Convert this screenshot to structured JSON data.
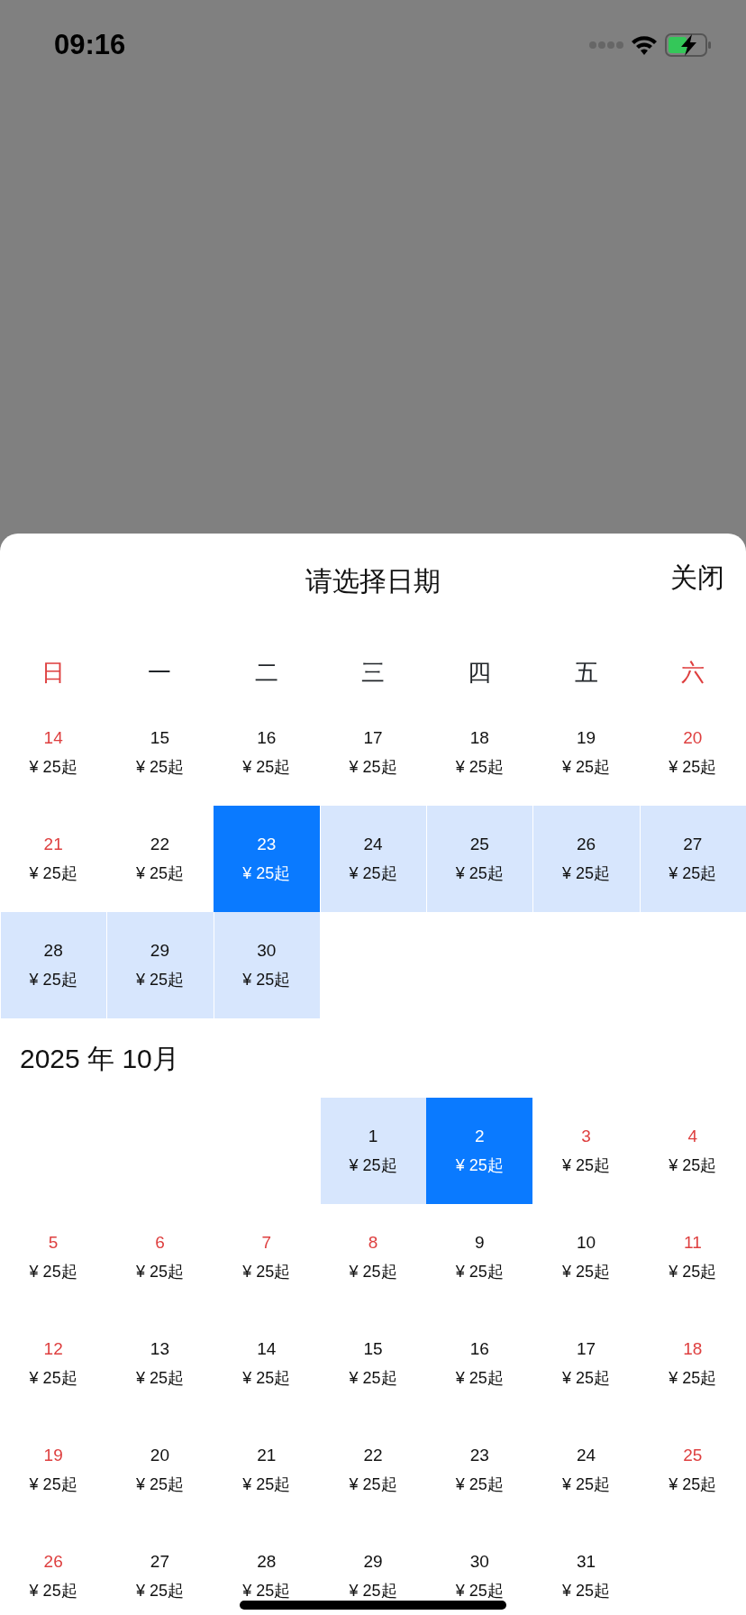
{
  "status_bar": {
    "time": "09:16"
  },
  "sheet": {
    "title": "请选择日期",
    "close_label": "关闭"
  },
  "weekdays": [
    {
      "label": "日",
      "rest_day": true
    },
    {
      "label": "一",
      "rest_day": false
    },
    {
      "label": "二",
      "rest_day": false
    },
    {
      "label": "三",
      "rest_day": false
    },
    {
      "label": "四",
      "rest_day": false
    },
    {
      "label": "五",
      "rest_day": false
    },
    {
      "label": "六",
      "rest_day": true
    }
  ],
  "months": [
    {
      "weeks": [
        [
          {
            "day": "14",
            "price": "¥ 25起",
            "rest_day": true,
            "selected": false,
            "in_range": false
          },
          {
            "day": "15",
            "price": "¥ 25起",
            "rest_day": false,
            "selected": false,
            "in_range": false
          },
          {
            "day": "16",
            "price": "¥ 25起",
            "rest_day": false,
            "selected": false,
            "in_range": false
          },
          {
            "day": "17",
            "price": "¥ 25起",
            "rest_day": false,
            "selected": false,
            "in_range": false
          },
          {
            "day": "18",
            "price": "¥ 25起",
            "rest_day": false,
            "selected": false,
            "in_range": false
          },
          {
            "day": "19",
            "price": "¥ 25起",
            "rest_day": false,
            "selected": false,
            "in_range": false
          },
          {
            "day": "20",
            "price": "¥ 25起",
            "rest_day": true,
            "selected": false,
            "in_range": false
          }
        ],
        [
          {
            "day": "21",
            "price": "¥ 25起",
            "rest_day": true,
            "selected": false,
            "in_range": false
          },
          {
            "day": "22",
            "price": "¥ 25起",
            "rest_day": false,
            "selected": false,
            "in_range": false
          },
          {
            "day": "23",
            "price": "¥ 25起",
            "rest_day": false,
            "selected": true,
            "in_range": false
          },
          {
            "day": "24",
            "price": "¥ 25起",
            "rest_day": false,
            "selected": false,
            "in_range": true
          },
          {
            "day": "25",
            "price": "¥ 25起",
            "rest_day": false,
            "selected": false,
            "in_range": true
          },
          {
            "day": "26",
            "price": "¥ 25起",
            "rest_day": false,
            "selected": false,
            "in_range": true
          },
          {
            "day": "27",
            "price": "¥ 25起",
            "rest_day": false,
            "selected": false,
            "in_range": true
          }
        ],
        [
          {
            "day": "28",
            "price": "¥ 25起",
            "rest_day": false,
            "selected": false,
            "in_range": true
          },
          {
            "day": "29",
            "price": "¥ 25起",
            "rest_day": false,
            "selected": false,
            "in_range": true
          },
          {
            "day": "30",
            "price": "¥ 25起",
            "rest_day": false,
            "selected": false,
            "in_range": true
          }
        ]
      ]
    },
    {
      "title": "2025 年 10月",
      "starts_midweek": true,
      "weeks": [
        [
          {
            "day": "1",
            "price": "¥ 25起",
            "rest_day": false,
            "selected": false,
            "in_range": true
          },
          {
            "day": "2",
            "price": "¥ 25起",
            "rest_day": false,
            "selected": true,
            "in_range": false
          },
          {
            "day": "3",
            "price": "¥ 25起",
            "rest_day": true,
            "selected": false,
            "in_range": false
          },
          {
            "day": "4",
            "price": "¥ 25起",
            "rest_day": true,
            "selected": false,
            "in_range": false
          }
        ],
        [
          {
            "day": "5",
            "price": "¥ 25起",
            "rest_day": true,
            "selected": false,
            "in_range": false
          },
          {
            "day": "6",
            "price": "¥ 25起",
            "rest_day": true,
            "selected": false,
            "in_range": false
          },
          {
            "day": "7",
            "price": "¥ 25起",
            "rest_day": true,
            "selected": false,
            "in_range": false
          },
          {
            "day": "8",
            "price": "¥ 25起",
            "rest_day": true,
            "selected": false,
            "in_range": false
          },
          {
            "day": "9",
            "price": "¥ 25起",
            "rest_day": false,
            "selected": false,
            "in_range": false
          },
          {
            "day": "10",
            "price": "¥ 25起",
            "rest_day": false,
            "selected": false,
            "in_range": false
          },
          {
            "day": "11",
            "price": "¥ 25起",
            "rest_day": true,
            "selected": false,
            "in_range": false
          }
        ],
        [
          {
            "day": "12",
            "price": "¥ 25起",
            "rest_day": true,
            "selected": false,
            "in_range": false
          },
          {
            "day": "13",
            "price": "¥ 25起",
            "rest_day": false,
            "selected": false,
            "in_range": false
          },
          {
            "day": "14",
            "price": "¥ 25起",
            "rest_day": false,
            "selected": false,
            "in_range": false
          },
          {
            "day": "15",
            "price": "¥ 25起",
            "rest_day": false,
            "selected": false,
            "in_range": false
          },
          {
            "day": "16",
            "price": "¥ 25起",
            "rest_day": false,
            "selected": false,
            "in_range": false
          },
          {
            "day": "17",
            "price": "¥ 25起",
            "rest_day": false,
            "selected": false,
            "in_range": false
          },
          {
            "day": "18",
            "price": "¥ 25起",
            "rest_day": true,
            "selected": false,
            "in_range": false
          }
        ],
        [
          {
            "day": "19",
            "price": "¥ 25起",
            "rest_day": true,
            "selected": false,
            "in_range": false
          },
          {
            "day": "20",
            "price": "¥ 25起",
            "rest_day": false,
            "selected": false,
            "in_range": false
          },
          {
            "day": "21",
            "price": "¥ 25起",
            "rest_day": false,
            "selected": false,
            "in_range": false
          },
          {
            "day": "22",
            "price": "¥ 25起",
            "rest_day": false,
            "selected": false,
            "in_range": false
          },
          {
            "day": "23",
            "price": "¥ 25起",
            "rest_day": false,
            "selected": false,
            "in_range": false
          },
          {
            "day": "24",
            "price": "¥ 25起",
            "rest_day": false,
            "selected": false,
            "in_range": false
          },
          {
            "day": "25",
            "price": "¥ 25起",
            "rest_day": true,
            "selected": false,
            "in_range": false
          }
        ],
        [
          {
            "day": "26",
            "price": "¥ 25起",
            "rest_day": true,
            "selected": false,
            "in_range": false
          },
          {
            "day": "27",
            "price": "¥ 25起",
            "rest_day": false,
            "selected": false,
            "in_range": false
          },
          {
            "day": "28",
            "price": "¥ 25起",
            "rest_day": false,
            "selected": false,
            "in_range": false
          },
          {
            "day": "29",
            "price": "¥ 25起",
            "rest_day": false,
            "selected": false,
            "in_range": false
          },
          {
            "day": "30",
            "price": "¥ 25起",
            "rest_day": false,
            "selected": false,
            "in_range": false
          },
          {
            "day": "31",
            "price": "¥ 25起",
            "rest_day": false,
            "selected": false,
            "in_range": false
          }
        ]
      ]
    }
  ]
}
